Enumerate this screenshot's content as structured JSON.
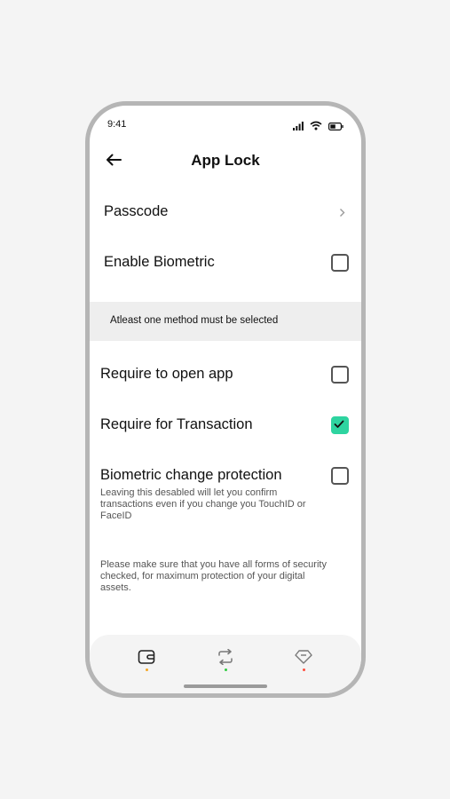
{
  "status_bar": {
    "time": "9:41"
  },
  "header": {
    "title": "App Lock"
  },
  "settings": {
    "passcode": {
      "label": "Passcode"
    },
    "enable_biometric": {
      "label": "Enable Biometric",
      "checked": false
    }
  },
  "notice": {
    "text": "Atleast one method must be selected"
  },
  "options": [
    {
      "label": "Require to open app",
      "checked": false
    },
    {
      "label": "Require for Transaction",
      "checked": true
    },
    {
      "label": "Biometric change protection",
      "checked": false,
      "description": "Leaving this desabled will let you confirm transactions even if you change you TouchID or FaceID"
    }
  ],
  "footer_note": "Please make sure that you have all forms of security checked, for maximum protection of your digital assets.",
  "bottom_nav": {
    "items": [
      {
        "icon": "wallet-icon",
        "dot_color": "#f5a623"
      },
      {
        "icon": "swap-icon",
        "dot_color": "#2ecc40"
      },
      {
        "icon": "diamond-icon",
        "dot_color": "#ff4d3d"
      }
    ]
  },
  "colors": {
    "accent": "#2ed4a0",
    "band": "#eeeeee"
  }
}
